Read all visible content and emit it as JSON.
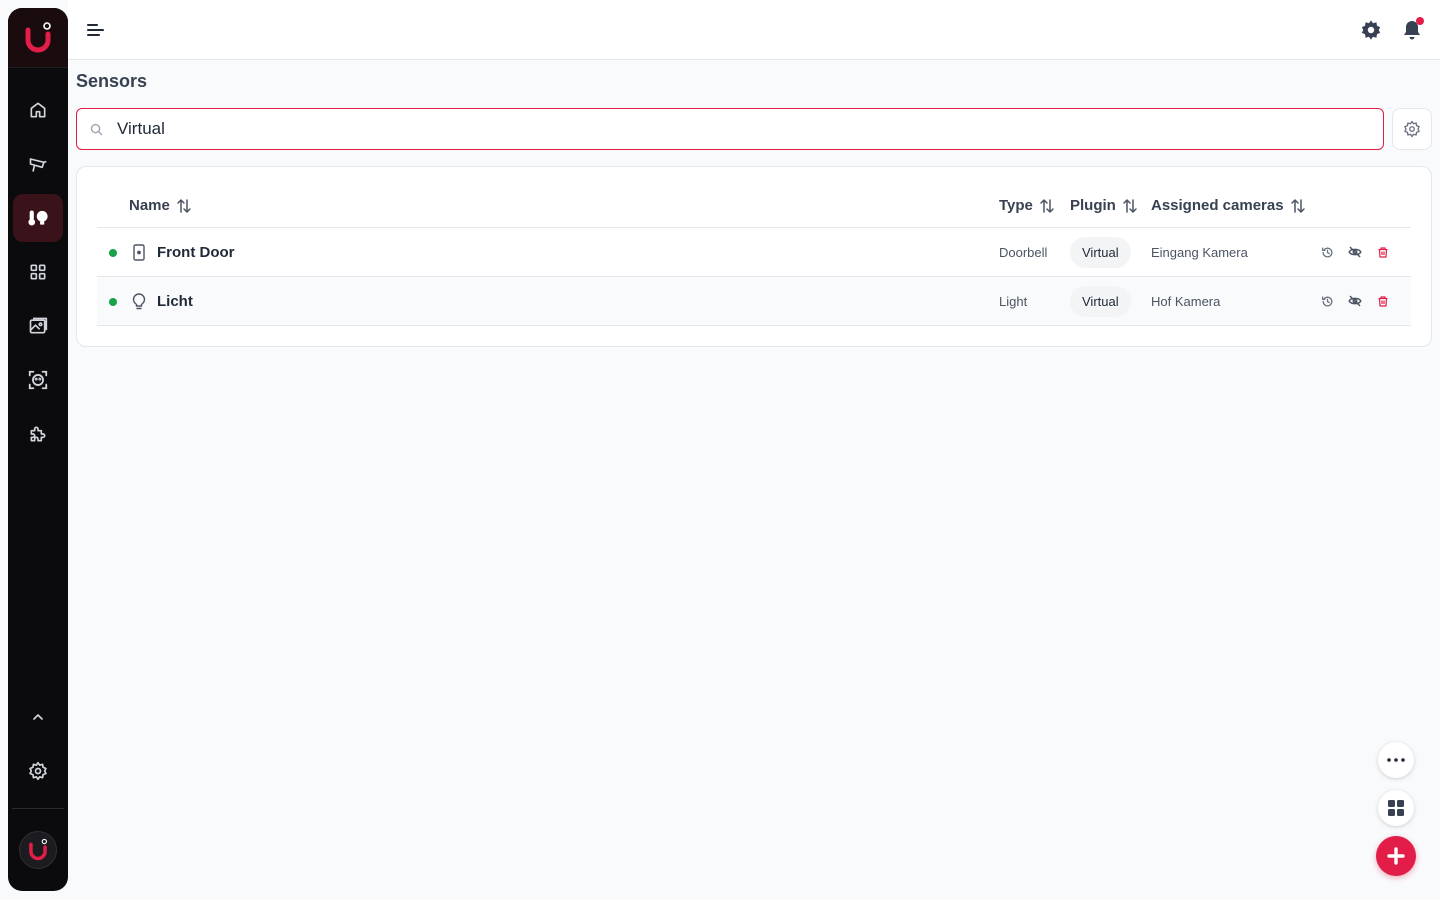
{
  "app": {
    "accent_color": "#e11d48",
    "sidebar_color": "#0b0b0d",
    "status_online_color": "#16a34a"
  },
  "sidebar": {
    "logo_icon": "camera-ui-logo",
    "items": [
      {
        "icon": "home-icon",
        "active": false
      },
      {
        "icon": "camera-icon",
        "active": false
      },
      {
        "icon": "sensors-icon",
        "active": true
      },
      {
        "icon": "grid-icon",
        "active": false
      },
      {
        "icon": "gallery-icon",
        "active": false
      },
      {
        "icon": "face-recognition-icon",
        "active": false
      },
      {
        "icon": "puzzle-icon",
        "active": false
      }
    ],
    "bottom_items": [
      {
        "icon": "chevron-up-icon"
      },
      {
        "icon": "gear-icon"
      }
    ]
  },
  "topbar": {
    "menu_icon": "menu-icon",
    "settings_icon": "gear-icon",
    "notifications_icon": "bell-icon",
    "has_notifications": true
  },
  "page": {
    "title": "Sensors"
  },
  "search": {
    "value": "Virtual",
    "placeholder": "Search"
  },
  "table": {
    "columns": [
      {
        "key": "name",
        "label": "Name"
      },
      {
        "key": "type",
        "label": "Type"
      },
      {
        "key": "plugin",
        "label": "Plugin"
      },
      {
        "key": "cameras",
        "label": "Assigned cameras"
      }
    ],
    "rows": [
      {
        "status": "online",
        "icon": "doorbell-icon",
        "name": "Front Door",
        "type": "Doorbell",
        "plugin": "Virtual",
        "cameras": "Eingang Kamera"
      },
      {
        "status": "online",
        "icon": "lightbulb-icon",
        "name": "Licht",
        "type": "Light",
        "plugin": "Virtual",
        "cameras": "Hof Kamera"
      }
    ],
    "row_actions": [
      "history-icon",
      "eye-off-icon",
      "trash-icon"
    ]
  },
  "fabs": [
    "more-icon",
    "grid-icon",
    "plus-icon"
  ]
}
